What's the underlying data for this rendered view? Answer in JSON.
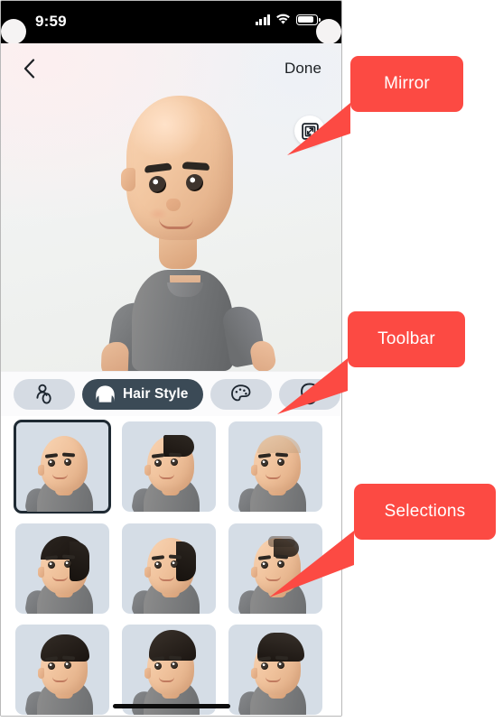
{
  "status_bar": {
    "time": "9:59",
    "signal_icon": "cellular-bars-icon",
    "wifi_icon": "wifi-icon",
    "battery_icon": "battery-icon"
  },
  "nav": {
    "back_icon": "chevron-left-icon",
    "done_label": "Done"
  },
  "preview": {
    "mirror_button_icon": "mirror-flip-icon",
    "avatar_name": "avatar-preview",
    "skin_tone": "#f2c6a0",
    "shirt_color": "#76787a",
    "hair": "none"
  },
  "toolbar": {
    "tabs": [
      {
        "id": "body",
        "icon": "person-body-icon",
        "label": "",
        "active": false
      },
      {
        "id": "hair-style",
        "icon": "hair-style-icon",
        "label": "Hair Style",
        "active": true
      },
      {
        "id": "hair-color",
        "icon": "color-palette-icon",
        "label": "",
        "active": false
      },
      {
        "id": "head-shape",
        "icon": "head-shape-icon",
        "label": "",
        "active": false
      },
      {
        "id": "face-shape",
        "icon": "face-shape-icon",
        "label": "",
        "active": false
      }
    ],
    "active_tab_bg": "#3b4a56",
    "inactive_tab_bg": "#d5dbe3"
  },
  "selections": {
    "cell_bg": "#d5dde6",
    "selected_outline": "#1f2a33",
    "selected_index": 0,
    "items": [
      {
        "id": "hair-0",
        "name": "no-hair",
        "hair": "none",
        "selected": true
      },
      {
        "id": "hair-1",
        "name": "receding-dark",
        "hair": "receding",
        "selected": false
      },
      {
        "id": "hair-2",
        "name": "thin-blond",
        "hair": "blond",
        "selected": false
      },
      {
        "id": "hair-3",
        "name": "balding-dark-sides",
        "hair": "crown",
        "selected": false
      },
      {
        "id": "hair-4",
        "name": "side-dark",
        "hair": "side",
        "selected": false
      },
      {
        "id": "hair-5",
        "name": "thinning-dark",
        "hair": "thin",
        "selected": false
      },
      {
        "id": "hair-6",
        "name": "short-dark",
        "hair": "short",
        "selected": false
      },
      {
        "id": "hair-7",
        "name": "quiff-dark",
        "hair": "quiff",
        "selected": false
      },
      {
        "id": "hair-8",
        "name": "comb-over-dark",
        "hair": "comb",
        "selected": false
      }
    ]
  },
  "home_indicator": "home-indicator-bar",
  "callouts": {
    "color": "#fc4a43",
    "items": [
      {
        "id": "mirror",
        "label": "Mirror"
      },
      {
        "id": "toolbar",
        "label": "Toolbar"
      },
      {
        "id": "selections",
        "label": "Selections"
      }
    ]
  }
}
